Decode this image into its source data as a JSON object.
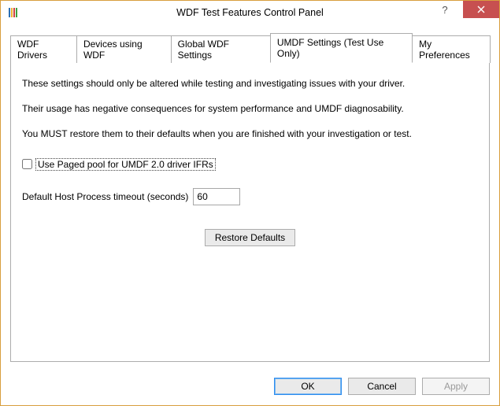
{
  "window": {
    "title": "WDF Test Features Control Panel"
  },
  "tabs": {
    "items": [
      {
        "label": "WDF Drivers"
      },
      {
        "label": "Devices using WDF"
      },
      {
        "label": "Global WDF Settings"
      },
      {
        "label": "UMDF Settings (Test Use Only)"
      },
      {
        "label": "My Preferences"
      }
    ],
    "activeIndex": 3
  },
  "panel": {
    "paragraphs": [
      "These settings should only be altered while testing and investigating issues with your driver.",
      "Their usage has negative consequences for system performance and UMDF diagnosability.",
      "You MUST restore them to their defaults when you are finished with your investigation or test."
    ],
    "checkbox": {
      "label": "Use Paged pool for UMDF 2.0 driver IFRs",
      "checked": false
    },
    "timeout": {
      "label": "Default Host Process timeout (seconds)",
      "value": "60"
    },
    "restore_button": "Restore Defaults"
  },
  "buttons": {
    "ok": "OK",
    "cancel": "Cancel",
    "apply": "Apply"
  }
}
